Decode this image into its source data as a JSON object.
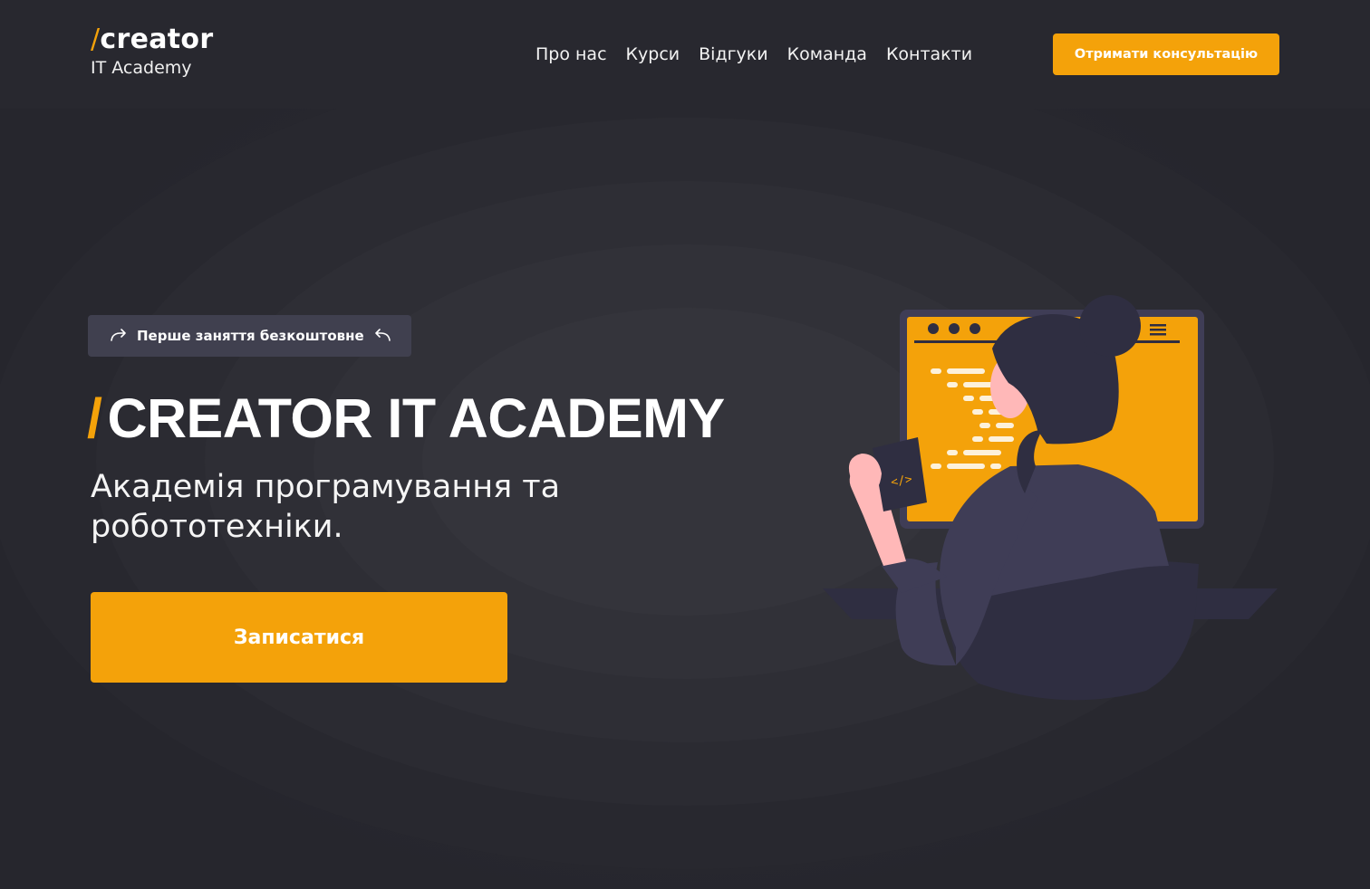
{
  "header": {
    "logo_slash": "/",
    "logo_name": "creator",
    "logo_subtitle": "IT Academy",
    "nav": [
      "Про нас",
      "Курси",
      "Відгуки",
      "Команда",
      "Контакти"
    ],
    "cta_label": "Отримати консультацію"
  },
  "hero": {
    "badge_text": "Перше заняття безкоштовне",
    "title_slash": "/",
    "title": "CREATOR IT ACADEMY",
    "subtitle": "Академія програмування та робототехніки.",
    "cta_label": "Записатися"
  },
  "illustration": {
    "code_badge": "</>"
  },
  "colors": {
    "accent": "#f4a20a",
    "background": "#26262e",
    "badge_bg": "#40404f",
    "figure_dark": "#2f2e41",
    "figure_shirt": "#3f3d56",
    "skin": "#ffb8b8"
  }
}
